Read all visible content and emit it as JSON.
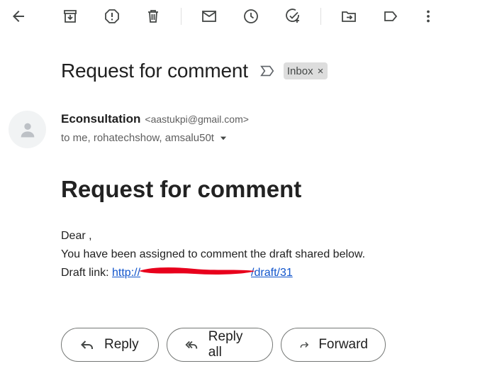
{
  "toolbar": {
    "icons": [
      "back-arrow-icon",
      "archive-icon",
      "report-spam-icon",
      "delete-icon",
      "mark-unread-icon",
      "snooze-icon",
      "add-to-tasks-icon",
      "move-to-icon",
      "label-icon",
      "more-options-icon"
    ]
  },
  "email": {
    "subject": "Request for comment",
    "label": "Inbox",
    "label_remove": "×",
    "sender_name": "Econsultation",
    "sender_email": "<aastukpi@gmail.com>",
    "recipients": "to me, rohatechshow, amsalu50t",
    "body": {
      "heading": "Request for comment",
      "greeting": "Dear ,",
      "line1": "You have been assigned to comment the draft shared below.",
      "link_prefix": "Draft link: ",
      "link_text": "http://196.188.███████████5/draft/31",
      "link_visible_start": "http://",
      "link_visible_end": "/draft/31"
    }
  },
  "actions": {
    "reply": "Reply",
    "reply_all": "Reply all",
    "forward": "Forward"
  },
  "colors": {
    "link": "#1155cc",
    "redaction": "#e8001c",
    "chip_bg": "#dddddd",
    "icon": "#444746"
  }
}
